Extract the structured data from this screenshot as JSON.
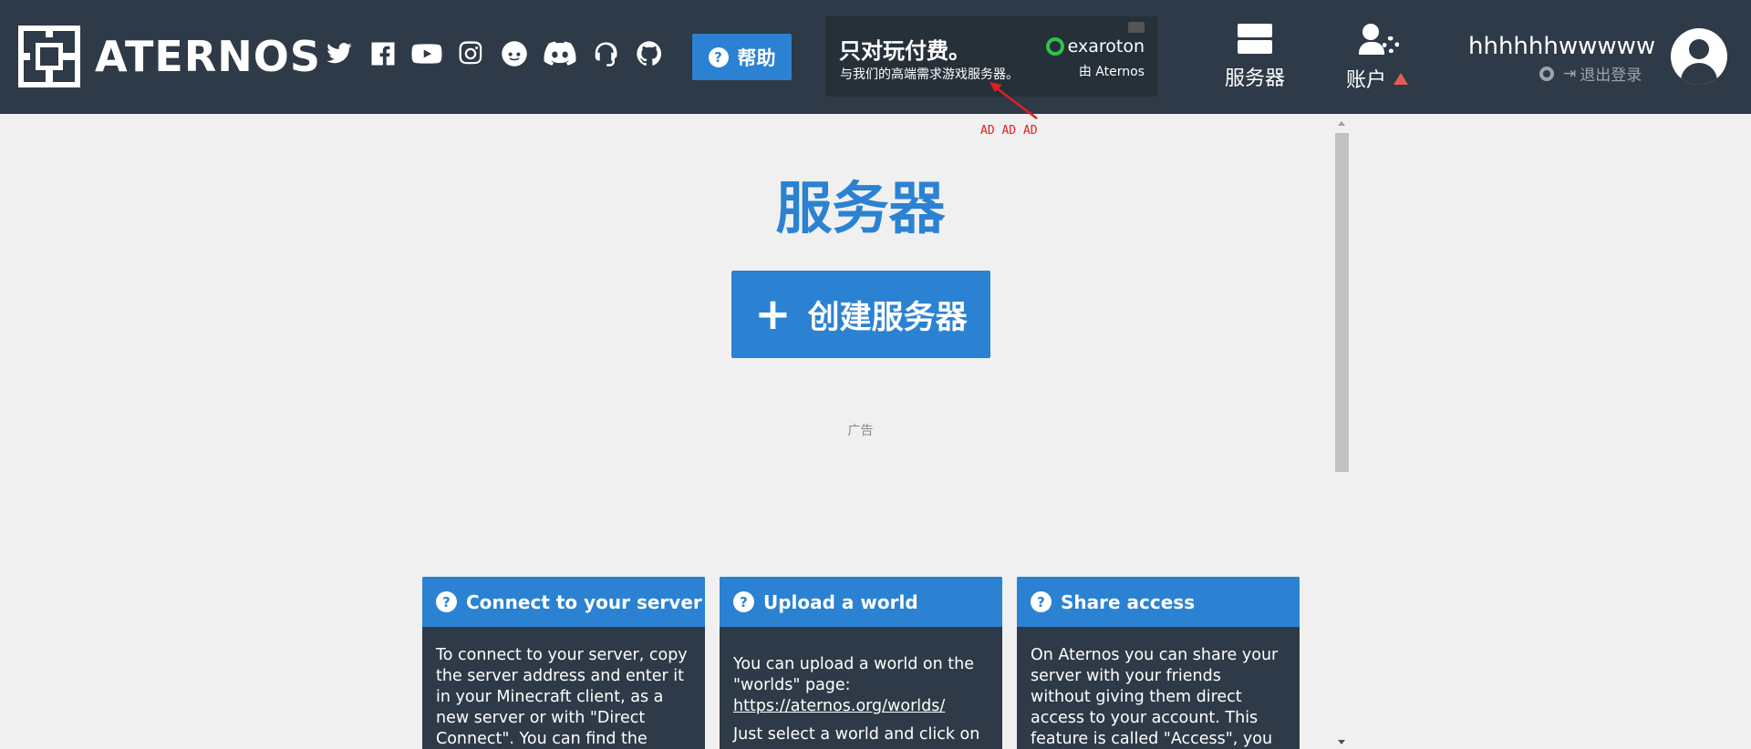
{
  "header": {
    "logo_text": "ATERNOS",
    "socials": [
      "twitter-icon",
      "facebook-icon",
      "youtube-icon",
      "instagram-icon",
      "reddit-icon",
      "discord-icon",
      "support-icon",
      "github-icon"
    ],
    "help_label": "帮助",
    "help_icon": "?",
    "ad": {
      "title": "只对玩付费。",
      "subtitle": "与我们的高端需求游戏服务器。",
      "brand": "exaroton",
      "by": "由 Aternos"
    },
    "ad_annotation": "AD AD AD",
    "nav_servers_label": "服务器",
    "nav_account_label": "账户",
    "username": "hhhhhhwwwww",
    "logout_label": "退出登录"
  },
  "main": {
    "title": "服务器",
    "create_button_icon": "+",
    "create_button_label": "创建服务器",
    "ad_note": "广告",
    "cards": [
      {
        "title": "Connect to your server",
        "lines": [
          "To connect to your server, copy the server address and enter it in your Minecraft client, as a new server or with \"Direct Connect\". You can find the"
        ]
      },
      {
        "title": "Upload a world",
        "text1": "You can upload a world on the \"worlds\" page:",
        "link": "https://aternos.org/worlds/",
        "text2": "Just select a world and click on"
      },
      {
        "title": "Share access",
        "lines": [
          "On Aternos you can share your server with your friends without giving them direct access to your account. This feature is called \"Access\", you"
        ]
      }
    ]
  },
  "colors": {
    "header_bg": "#2e3a47",
    "accent": "#2b82d2",
    "page_bg": "#f0f0f0",
    "warning": "#e35d4f",
    "annotation": "#e02020"
  }
}
